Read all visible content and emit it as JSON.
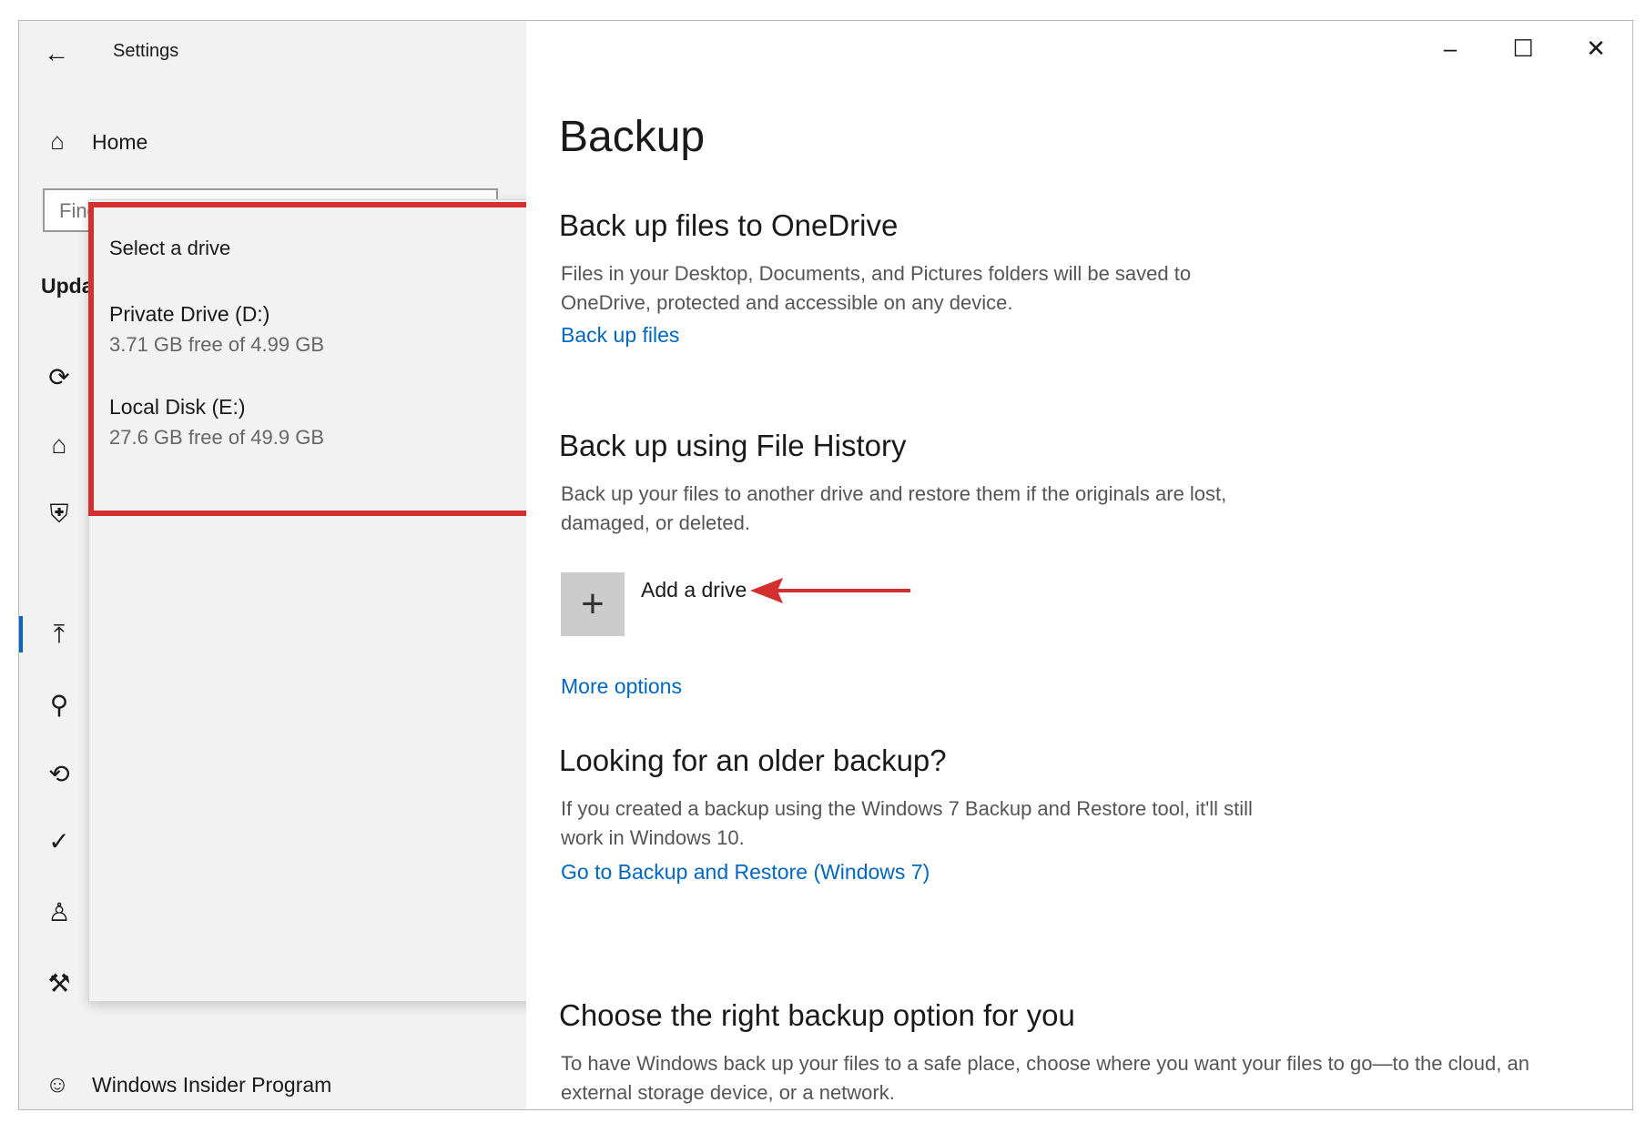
{
  "window": {
    "title": "Settings",
    "back_icon": "←",
    "minimize_icon": "–",
    "maximize_icon": "☐",
    "close_icon": "✕"
  },
  "sidebar": {
    "home_label": "Home",
    "home_icon": "⌂",
    "search_placeholder": "Find a setting",
    "section_label": "Update & Security",
    "icons": [
      {
        "name": "windows-update-icon",
        "glyph": "⟳"
      },
      {
        "name": "delivery-optimization-icon",
        "glyph": "⌂"
      },
      {
        "name": "windows-security-icon",
        "glyph": "⛨"
      },
      {
        "name": "backup-icon",
        "glyph": "⤒"
      },
      {
        "name": "troubleshoot-icon",
        "glyph": "⚲"
      },
      {
        "name": "recovery-icon",
        "glyph": "⟲"
      },
      {
        "name": "activation-icon",
        "glyph": "✓"
      },
      {
        "name": "find-my-device-icon",
        "glyph": "♙"
      },
      {
        "name": "for-developers-icon",
        "glyph": "⚒"
      }
    ],
    "insider_label": "Windows Insider Program",
    "insider_icon": "☺"
  },
  "flyout": {
    "title": "Select a drive",
    "drives": [
      {
        "name": "Private Drive (D:)",
        "free": "3.71 GB free of 4.99 GB"
      },
      {
        "name": "Local Disk (E:)",
        "free": "27.6 GB free of 49.9 GB"
      }
    ]
  },
  "main": {
    "title": "Backup",
    "onedrive": {
      "heading": "Back up files to OneDrive",
      "desc": "Files in your Desktop, Documents, and Pictures folders will be saved to OneDrive, protected and accessible on any device.",
      "link": "Back up files"
    },
    "file_history": {
      "heading": "Back up using File History",
      "desc": "Back up your files to another drive and restore them if the originals are lost, damaged, or deleted.",
      "add_icon": "+",
      "add_label": "Add a drive",
      "more_link": "More options"
    },
    "older": {
      "heading": "Looking for an older backup?",
      "desc": "If you created a backup using the Windows 7 Backup and Restore tool, it'll still work in Windows 10.",
      "link": "Go to Backup and Restore (Windows 7)"
    },
    "choose": {
      "heading": "Choose the right backup option for you",
      "desc": "To have Windows back up your files to a safe place, choose where you want your files to go—to the cloud, an external storage device, or a network."
    }
  },
  "colors": {
    "accent": "#0067c0",
    "highlight": "#d32f2f"
  }
}
